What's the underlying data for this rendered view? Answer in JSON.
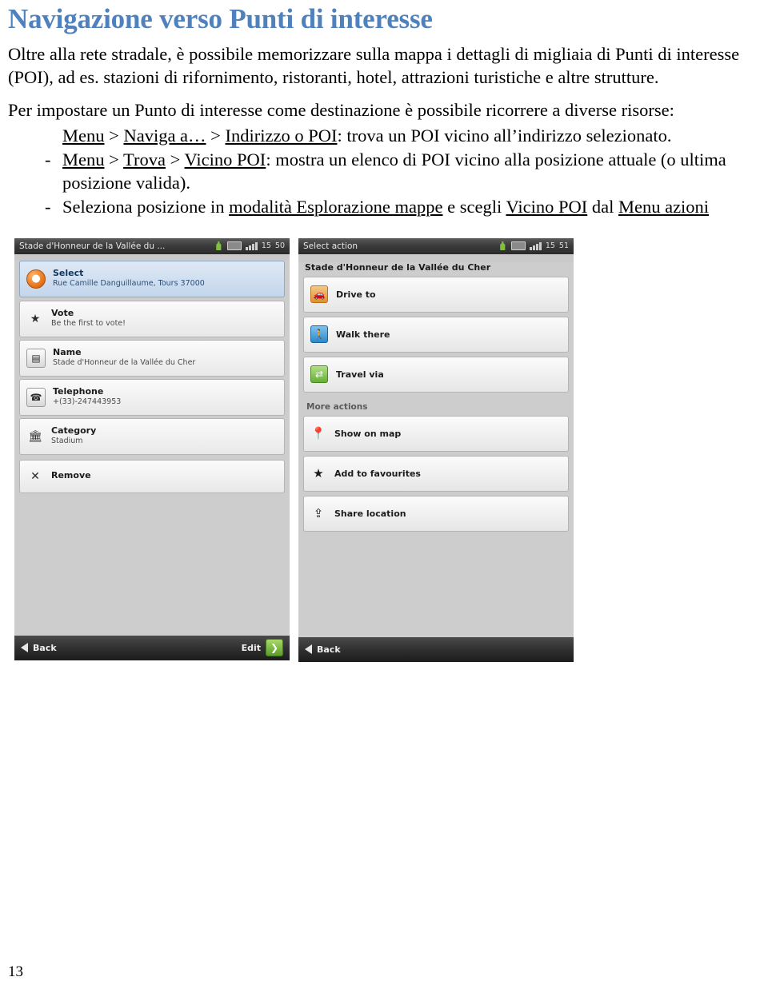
{
  "document": {
    "title": "Navigazione verso Punti di interesse",
    "intro": "Oltre alla rete stradale, è possibile memorizzare sulla mappa i dettagli di migliaia di Punti di interesse (POI), ad es. stazioni di rifornimento, ristoranti, hotel, attrazioni turistiche e altre strutture.",
    "lead": "Per impostare un Punto di interesse come destinazione è possibile ricorrere a diverse risorse:",
    "bullets": [
      {
        "dash": "",
        "parts": [
          {
            "text": "Menu",
            "underline": true
          },
          {
            "text": " > ",
            "underline": false
          },
          {
            "text": "Naviga a…",
            "underline": true
          },
          {
            "text": " > ",
            "underline": false
          },
          {
            "text": "Indirizzo o POI",
            "underline": true
          },
          {
            "text": ": trova un POI vicino all’indirizzo selezionato.",
            "underline": false
          }
        ]
      },
      {
        "dash": "-",
        "parts": [
          {
            "text": "Menu",
            "underline": true
          },
          {
            "text": " > ",
            "underline": false
          },
          {
            "text": "Trova",
            "underline": true
          },
          {
            "text": " > ",
            "underline": false
          },
          {
            "text": "Vicino POI",
            "underline": true
          },
          {
            "text": ": mostra un elenco di POI vicino alla posizione attuale (o ultima posizione valida).",
            "underline": false
          }
        ]
      },
      {
        "dash": "-",
        "parts": [
          {
            "text": "Seleziona posizione in ",
            "underline": false
          },
          {
            "text": "modalità Esplorazione mappe",
            "underline": true
          },
          {
            "text": " e scegli ",
            "underline": false
          },
          {
            "text": "Vicino POI",
            "underline": true
          },
          {
            "text": " dal ",
            "underline": false
          },
          {
            "text": "Menu azioni",
            "underline": true
          }
        ]
      }
    ],
    "page_number": "13",
    "accent_color": "#4f81bd"
  },
  "screenshot_left": {
    "titlebar": {
      "title": "Stade d'Honneur de la Vallée du ...",
      "status_time": "15",
      "status_minutes": "50"
    },
    "header": {
      "title": "Select",
      "subtitle": "Rue Camille Danguillaume,  Tours 37000",
      "icon": "poi-marker-icon"
    },
    "rows": [
      {
        "icon": "star-icon",
        "title": "Vote",
        "subtitle": "Be the first to vote!"
      },
      {
        "icon": "name-tag-icon",
        "title": "Name",
        "subtitle": "Stade d'Honneur de la Vallée du Cher"
      },
      {
        "icon": "telephone-icon",
        "title": "Telephone",
        "subtitle": "+(33)-247443953"
      },
      {
        "icon": "category-icon",
        "title": "Category",
        "subtitle": "Stadium"
      },
      {
        "icon": "remove-x-icon",
        "title": "Remove",
        "subtitle": ""
      }
    ],
    "bottombar": {
      "back_label": "Back",
      "edit_label": "Edit"
    }
  },
  "screenshot_right": {
    "titlebar": {
      "title": "Select action",
      "status_time": "15",
      "status_minutes": "51"
    },
    "heading": "Stade d'Honneur de la Vallée du Cher",
    "primary_actions": [
      {
        "icon": "car-icon",
        "label": "Drive to"
      },
      {
        "icon": "pedestrian-icon",
        "label": "Walk there"
      },
      {
        "icon": "travel-via-icon",
        "label": "Travel via"
      }
    ],
    "more_actions_label": "More actions",
    "more_actions": [
      {
        "icon": "map-pin-icon",
        "label": "Show on map"
      },
      {
        "icon": "star-icon",
        "label": "Add to favourites"
      },
      {
        "icon": "share-location-icon",
        "label": "Share location"
      }
    ],
    "bottombar": {
      "back_label": "Back"
    }
  }
}
